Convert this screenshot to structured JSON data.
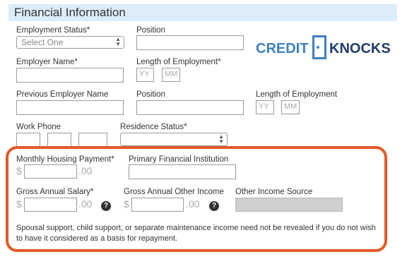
{
  "section": {
    "title": "Financial Information"
  },
  "logo": {
    "text_left": "CREDIT",
    "text_right": "KNOCKS"
  },
  "fields": {
    "employment_status": {
      "label": "Employment Status*",
      "value": "Select One"
    },
    "position1": {
      "label": "Position"
    },
    "employer_name": {
      "label": "Employer Name*"
    },
    "length_employment": {
      "label": "Length of Employment*",
      "yy": "YY",
      "mm": "MM"
    },
    "previous_employer": {
      "label": "Previous Employer Name"
    },
    "position2": {
      "label": "Position"
    },
    "length_employment2": {
      "label": "Length of Employment",
      "yy": "YY",
      "mm": "MM"
    },
    "work_phone": {
      "label": "Work Phone"
    },
    "residence_status": {
      "label": "Residence Status*"
    },
    "monthly_housing": {
      "label": "Monthly Housing Payment*",
      "currency": "$",
      "cents": ".00"
    },
    "primary_institution": {
      "label": "Primary Financial Institution"
    },
    "gross_salary": {
      "label": "Gross Annual Salary*",
      "currency": "$",
      "cents": ".00"
    },
    "gross_other": {
      "label": "Gross Annual Other Income",
      "currency": "$",
      "cents": ".00"
    },
    "other_source": {
      "label": "Other Income Source"
    }
  },
  "help_glyph": "?",
  "disclaimer": "Spousal support, child support, or separate maintenance income need not be revealed if you do not wish to have it considered as a basis for repayment.",
  "colors": {
    "header_bg": "#dcedf9",
    "highlight": "#e35a26",
    "logo_blue": "#1f4e8c",
    "disabled": "#cfcfcf"
  }
}
